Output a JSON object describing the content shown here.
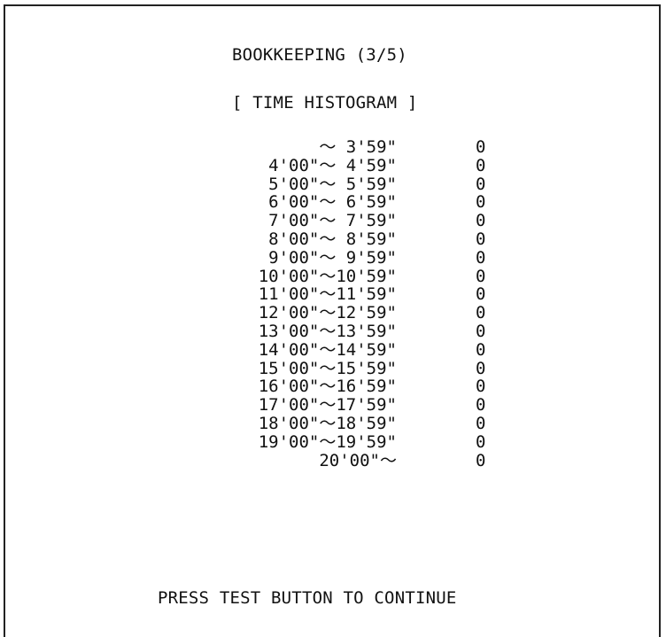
{
  "screen": {
    "title": "BOOKKEEPING (3/5)",
    "subtitle": "[ TIME HISTOGRAM ]",
    "footer": "PRESS TEST BUTTON TO CONTINUE"
  },
  "histogram": {
    "rows": [
      {
        "range": "〜 3'59\"",
        "count": "0"
      },
      {
        "range": "4'00\"〜 4'59\"",
        "count": "0"
      },
      {
        "range": "5'00\"〜 5'59\"",
        "count": "0"
      },
      {
        "range": "6'00\"〜 6'59\"",
        "count": "0"
      },
      {
        "range": "7'00\"〜 7'59\"",
        "count": "0"
      },
      {
        "range": "8'00\"〜 8'59\"",
        "count": "0"
      },
      {
        "range": "9'00\"〜 9'59\"",
        "count": "0"
      },
      {
        "range": "10'00\"〜10'59\"",
        "count": "0"
      },
      {
        "range": "11'00\"〜11'59\"",
        "count": "0"
      },
      {
        "range": "12'00\"〜12'59\"",
        "count": "0"
      },
      {
        "range": "13'00\"〜13'59\"",
        "count": "0"
      },
      {
        "range": "14'00\"〜14'59\"",
        "count": "0"
      },
      {
        "range": "15'00\"〜15'59\"",
        "count": "0"
      },
      {
        "range": "16'00\"〜16'59\"",
        "count": "0"
      },
      {
        "range": "17'00\"〜17'59\"",
        "count": "0"
      },
      {
        "range": "18'00\"〜18'59\"",
        "count": "0"
      },
      {
        "range": "19'00\"〜19'59\"",
        "count": "0"
      },
      {
        "range": "20'00\"〜",
        "count": "0"
      }
    ]
  }
}
